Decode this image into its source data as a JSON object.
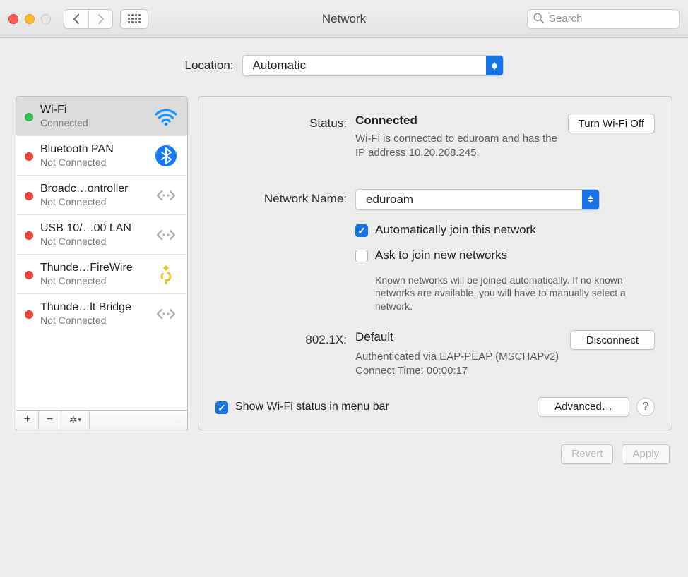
{
  "window": {
    "title": "Network",
    "search_placeholder": "Search"
  },
  "location": {
    "label": "Location:",
    "value": "Automatic"
  },
  "sidebar": {
    "services": [
      {
        "name": "Wi-Fi",
        "status": "Connected",
        "dot": "green",
        "icon": "wifi",
        "selected": true
      },
      {
        "name": "Bluetooth PAN",
        "status": "Not Connected",
        "dot": "red",
        "icon": "bluetooth",
        "selected": false
      },
      {
        "name": "Broadc…ontroller",
        "status": "Not Connected",
        "dot": "red",
        "icon": "diamond",
        "selected": false
      },
      {
        "name": "USB 10/…00 LAN",
        "status": "Not Connected",
        "dot": "red",
        "icon": "diamond",
        "selected": false
      },
      {
        "name": "Thunde…FireWire",
        "status": "Not Connected",
        "dot": "red",
        "icon": "firewire",
        "selected": false
      },
      {
        "name": "Thunde…lt Bridge",
        "status": "Not Connected",
        "dot": "red",
        "icon": "diamond",
        "selected": false
      }
    ],
    "actions": {
      "add": "+",
      "remove": "−",
      "gear": "⚙︎"
    }
  },
  "detail": {
    "status_label": "Status:",
    "status_value": "Connected",
    "wifi_off_button": "Turn Wi-Fi Off",
    "status_desc": "Wi-Fi is connected to eduroam and has the IP address 10.20.208.245.",
    "network_name_label": "Network Name:",
    "network_name_value": "eduroam",
    "auto_join_label": "Automatically join this network",
    "auto_join_checked": true,
    "ask_join_label": "Ask to join new networks",
    "ask_join_checked": false,
    "ask_join_desc": "Known networks will be joined automatically. If no known networks are available, you will have to manually select a network.",
    "dot1x_label": "802.1X:",
    "dot1x_value": "Default",
    "disconnect_button": "Disconnect",
    "dot1x_desc1": "Authenticated via EAP-PEAP (MSCHAPv2)",
    "dot1x_desc2": "Connect Time: 00:00:17",
    "show_menubar_label": "Show Wi-Fi status in menu bar",
    "show_menubar_checked": true,
    "advanced_button": "Advanced…",
    "help_button": "?"
  },
  "page_actions": {
    "revert": "Revert",
    "apply": "Apply"
  }
}
